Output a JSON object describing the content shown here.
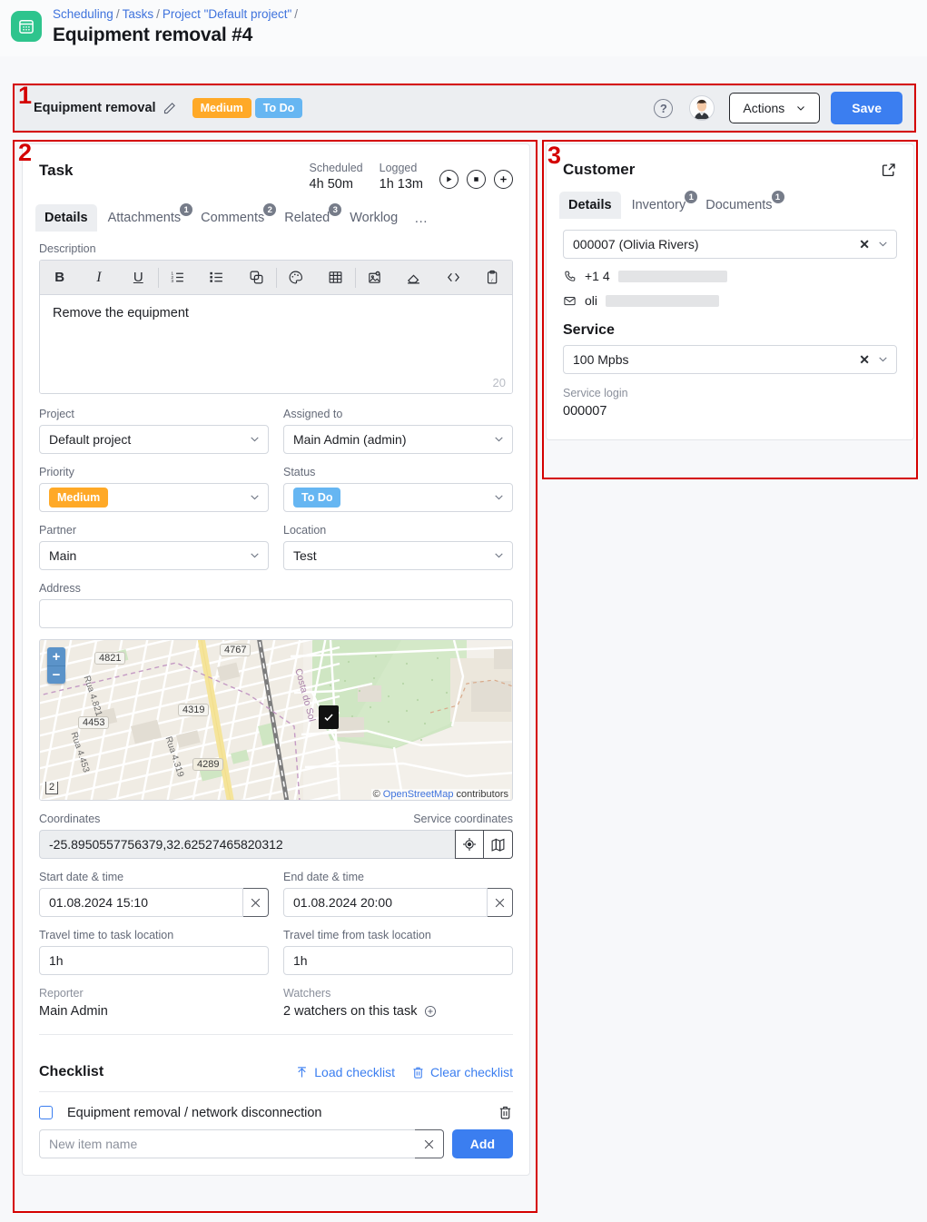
{
  "header": {
    "app_icon": "calendar-icon",
    "breadcrumb": [
      "Scheduling",
      "Tasks",
      "Project \"Default project\""
    ],
    "title": "Equipment removal #4",
    "accent_green": "#2ec48d"
  },
  "toolbar": {
    "title": "Equipment removal",
    "edit_icon": "pencil-icon",
    "priority_badge": "Medium",
    "status_badge": "To Do",
    "priority_color": "#ffa927",
    "status_color": "#66b6f2",
    "help_icon": "question-mark-icon",
    "avatar": "user-avatar",
    "actions_label": "Actions",
    "save_label": "Save",
    "save_color": "#3b7ef0"
  },
  "task": {
    "heading": "Task",
    "scheduled_label": "Scheduled",
    "scheduled_value": "4h 50m",
    "logged_label": "Logged",
    "logged_value": "1h 13m",
    "timer_buttons": [
      "play-icon",
      "stop-icon",
      "plus-icon"
    ],
    "tabs": [
      {
        "label": "Details",
        "count": "",
        "active": true
      },
      {
        "label": "Attachments",
        "count": "1",
        "active": false
      },
      {
        "label": "Comments",
        "count": "2",
        "active": false
      },
      {
        "label": "Related",
        "count": "3",
        "active": false
      },
      {
        "label": "Worklog",
        "count": "",
        "active": false
      }
    ],
    "tab_more": "…",
    "description": {
      "label": "Description",
      "toolbar_icons": [
        "bold-icon",
        "italic-icon",
        "underline-icon",
        "ordered-list-icon",
        "bullet-list-icon",
        "copy-icon",
        "palette-icon",
        "table-icon",
        "insert-image-icon",
        "eraser-icon",
        "code-icon",
        "paste-icon"
      ],
      "bold_label": "B",
      "italic_label": "I",
      "underline_label": "U",
      "text": "Remove the equipment",
      "char_count": "20"
    },
    "fields": {
      "project_label": "Project",
      "project_value": "Default project",
      "assigned_label": "Assigned to",
      "assigned_value": "Main Admin (admin)",
      "priority_label": "Priority",
      "priority_value": "Medium",
      "status_label": "Status",
      "status_value": "To Do",
      "partner_label": "Partner",
      "partner_value": "Main",
      "location_label": "Location",
      "location_value": "Test",
      "address_label": "Address",
      "address_value": ""
    },
    "map": {
      "zoom_in": "+",
      "zoom_out": "−",
      "scale_label": "2",
      "attribution_prefix": "©",
      "attribution_link": "OpenStreetMap",
      "attribution_suffix": "contributors",
      "street_labels": [
        "Rua 4.821",
        "Rua 4.453",
        "Rua 4.319",
        "Costa do Sol"
      ],
      "house_numbers": [
        "4821",
        "4767",
        "4319",
        "4453",
        "4289"
      ],
      "marker_icon": "check-marker-icon"
    },
    "coordinates": {
      "label": "Coordinates",
      "service_label": "Service coordinates",
      "value": "-25.8950557756379,32.62527465820312",
      "locate_icon": "crosshair-icon",
      "map_icon": "map-icon"
    },
    "dates": {
      "start_label": "Start date & time",
      "start_value": "01.08.2024 15:10",
      "end_label": "End date & time",
      "end_value": "01.08.2024 20:00",
      "clear_icon": "close-icon"
    },
    "travel": {
      "to_label": "Travel time to task location",
      "to_value": "1h",
      "from_label": "Travel time from task location",
      "from_value": "1h"
    },
    "reporter_label": "Reporter",
    "reporter_value": "Main Admin",
    "watchers_label": "Watchers",
    "watchers_value": "2 watchers on this task",
    "watchers_add_icon": "plus-circle-icon"
  },
  "checklist": {
    "heading": "Checklist",
    "load_label": "Load checklist",
    "load_icon": "upload-icon",
    "clear_label": "Clear checklist",
    "clear_icon": "trash-icon",
    "items": [
      {
        "label": "Equipment removal / network disconnection",
        "checked": false,
        "delete_icon": "trash-icon"
      }
    ],
    "new_item_placeholder": "New item name",
    "new_item_value": "",
    "clear_input_icon": "close-icon",
    "add_label": "Add"
  },
  "customer": {
    "heading": "Customer",
    "open_icon": "external-link-icon",
    "tabs": [
      {
        "label": "Details",
        "count": "",
        "active": true
      },
      {
        "label": "Inventory",
        "count": "1",
        "active": false
      },
      {
        "label": "Documents",
        "count": "1",
        "active": false
      }
    ],
    "selected_customer": "000007 (Olivia Rivers)",
    "clear_symbol": "✕",
    "phone_icon": "phone-icon",
    "phone_value": "+1 4",
    "email_icon": "mail-icon",
    "email_value": "oli",
    "service_heading": "Service",
    "service_value": "100 Mpbs",
    "service_login_label": "Service login",
    "service_login_value": "000007"
  },
  "annotations": [
    {
      "number": "1"
    },
    {
      "number": "2"
    },
    {
      "number": "3"
    }
  ]
}
